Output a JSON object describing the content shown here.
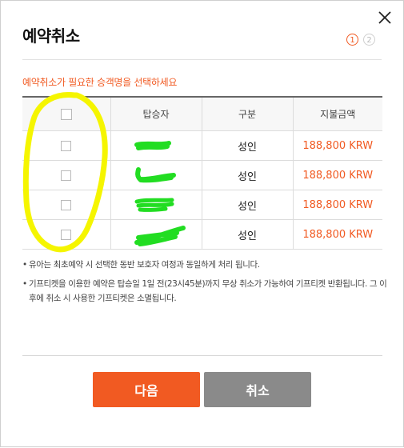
{
  "dialog": {
    "title": "예약취소",
    "steps": [
      "1",
      "2"
    ],
    "active_step": 1
  },
  "instruction": "예약취소가 필요한 승객명을 선택하세요",
  "table": {
    "headers": {
      "passenger": "탑승자",
      "type": "구분",
      "amount": "지불금액"
    },
    "rows": [
      {
        "type": "성인",
        "amount": "188,800 KRW"
      },
      {
        "type": "성인",
        "amount": "188,800 KRW"
      },
      {
        "type": "성인",
        "amount": "188,800 KRW"
      },
      {
        "type": "성인",
        "amount": "188,800 KRW"
      }
    ]
  },
  "notes": [
    "유아는 최초예약 시 선택한 동반 보호자 여정과 동일하게 처리 됩니다.",
    "기프티켓을 이용한 예약은 탑승일 1일 전(23시45분)까지 무상 취소가 가능하여 기프티켓 반환됩니다. 그 이후에 취소 시 사용한 기프티켓은 소멸됩니다."
  ],
  "buttons": {
    "next": "다음",
    "cancel": "취소"
  },
  "colors": {
    "accent": "#f15a22",
    "cancel_button": "#8a8a8a",
    "highlight": "#f5f500",
    "redaction": "#22dd22"
  },
  "icons": {
    "close": "close-icon"
  }
}
